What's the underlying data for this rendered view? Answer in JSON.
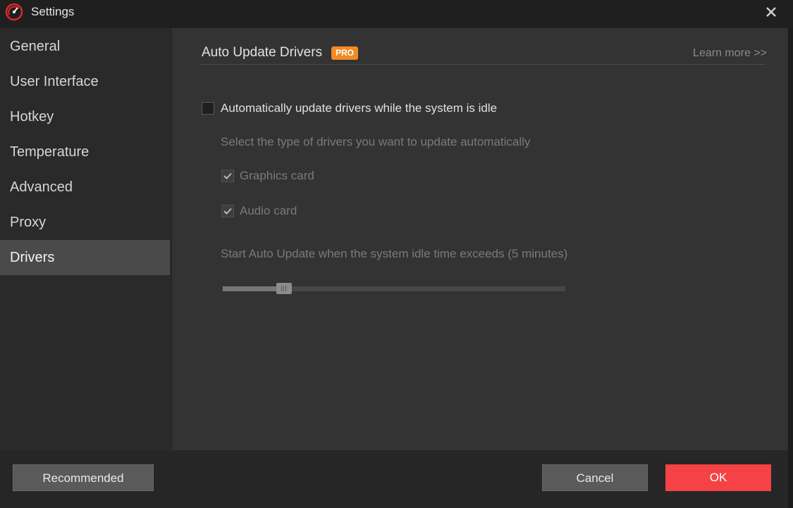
{
  "window": {
    "title": "Settings",
    "logo_icon": "speedometer-logo-icon",
    "close_icon": "close-icon"
  },
  "sidebar": {
    "items": [
      {
        "label": "General",
        "active": false
      },
      {
        "label": "User Interface",
        "active": false
      },
      {
        "label": "Hotkey",
        "active": false
      },
      {
        "label": "Temperature",
        "active": false
      },
      {
        "label": "Advanced",
        "active": false
      },
      {
        "label": "Proxy",
        "active": false
      },
      {
        "label": "Drivers",
        "active": true
      }
    ]
  },
  "main": {
    "section_title": "Auto Update Drivers",
    "pro_badge": "PRO",
    "learn_more": "Learn more >>",
    "auto_update": {
      "label": "Automatically update drivers while the system is idle",
      "checked": false
    },
    "driver_types_hint": "Select the type of drivers you want to update automatically",
    "graphics_card": {
      "label": "Graphics card",
      "checked": true
    },
    "audio_card": {
      "label": "Audio card",
      "checked": true
    },
    "idle_time_label": "Start Auto Update when the system idle time exceeds (5 minutes)",
    "idle_slider": {
      "value_fraction": 0.18
    }
  },
  "footer": {
    "recommended_label": "Recommended",
    "cancel_label": "Cancel",
    "ok_label": "OK"
  },
  "colors": {
    "accent_ok": "#f44245",
    "pro_badge": "#f08a24",
    "logo_red": "#e0262a"
  }
}
